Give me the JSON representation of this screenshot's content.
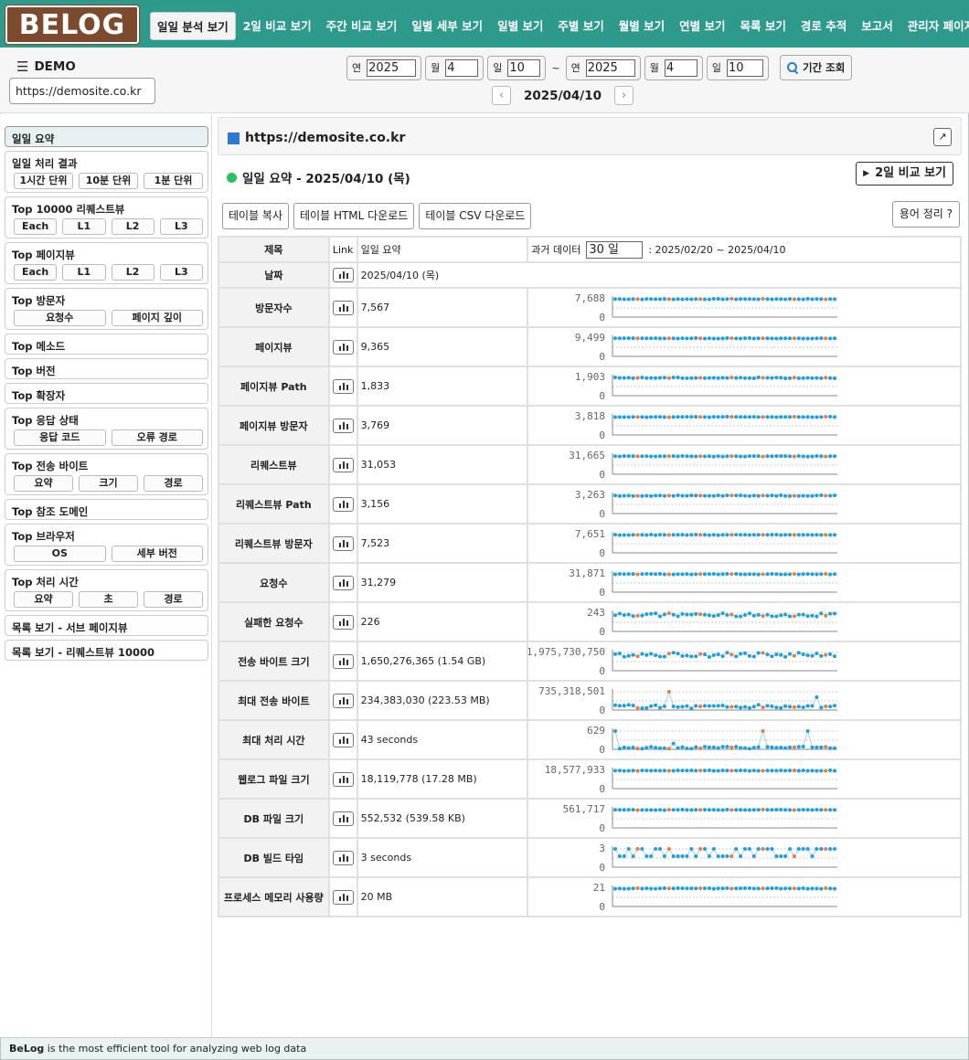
{
  "logo": {
    "text": "BELOG"
  },
  "nav": [
    {
      "label": "일일 분석 보기",
      "active": true
    },
    {
      "label": "2일 비교 보기"
    },
    {
      "label": "주간 비교 보기"
    },
    {
      "label": "일별 세부 보기"
    },
    {
      "label": "일별 보기"
    },
    {
      "label": "주별 보기"
    },
    {
      "label": "월별 보기"
    },
    {
      "label": "연별 보기"
    },
    {
      "label": "목록 보기"
    },
    {
      "label": "경로 추적"
    },
    {
      "label": "보고서"
    },
    {
      "label": "관리자 페이지"
    }
  ],
  "header": {
    "site_name": "DEMO",
    "site_url": "https://demosite.co.kr",
    "from": {
      "year_label": "연",
      "year": "2025",
      "month_label": "월",
      "month": "4",
      "day_label": "일",
      "day": "10"
    },
    "tilde": "~",
    "to": {
      "year_label": "연",
      "year": "2025",
      "month_label": "월",
      "month": "4",
      "day_label": "일",
      "day": "10"
    },
    "search_label": "기간 조회",
    "current_date": "2025/04/10",
    "prev_arrow": "‹",
    "next_arrow": "›"
  },
  "sidebar": [
    {
      "title": "일일 요약",
      "active": true,
      "buttons": []
    },
    {
      "title": "일일 처리 결과",
      "buttons": [
        "1시간 단위",
        "10분 단위",
        "1분 단위"
      ]
    },
    {
      "title": "Top 10000 리퀘스트뷰",
      "buttons": [
        "Each",
        "L1",
        "L2",
        "L3"
      ]
    },
    {
      "title": "Top 페이지뷰",
      "buttons": [
        "Each",
        "L1",
        "L2",
        "L3"
      ]
    },
    {
      "title": "Top 방문자",
      "buttons": [
        "요청수",
        "페이지 깊이"
      ]
    },
    {
      "title": "Top 메소드",
      "buttons": []
    },
    {
      "title": "Top 버전",
      "buttons": []
    },
    {
      "title": "Top 확장자",
      "buttons": []
    },
    {
      "title": "Top 응답 상태",
      "buttons": [
        "응답 코드",
        "오류 경로"
      ]
    },
    {
      "title": "Top 전송 바이트",
      "buttons": [
        "요약",
        "크기",
        "경로"
      ]
    },
    {
      "title": "Top 참조 도메인",
      "buttons": []
    },
    {
      "title": "Top 브라우저",
      "buttons": [
        "OS",
        "세부 버전"
      ]
    },
    {
      "title": "Top 처리 시간",
      "buttons": [
        "요약",
        "초",
        "경로"
      ]
    },
    {
      "title": "목록 보기 - 서브 페이지뷰",
      "buttons": []
    },
    {
      "title": "목록 보기 - 리퀘스트뷰 10000",
      "buttons": []
    }
  ],
  "main": {
    "site_title": "https://demosite.co.kr",
    "ext_icon": "↗",
    "summary_title": "일일 요약 - 2025/04/10 (목)",
    "compare_btn": "2일 비교 보기",
    "compare_icon": "▶",
    "tools": [
      "테이블 복사",
      "테이블 HTML 다운로드",
      "테이블 CSV 다운로드"
    ],
    "glossary": "용어 정리 ?",
    "table": {
      "h_name": "제목",
      "h_link": "Link",
      "h_value": "일일 요약",
      "h_past_label": "과거 데이터",
      "h_days": "30 일",
      "h_range": ": 2025/02/20 ~ 2025/04/10",
      "date_label": "날짜",
      "date_value": "2025/04/10 (목)"
    },
    "rows": [
      {
        "name": "방문자수",
        "value": "7,567",
        "max": "7,688",
        "min": "0",
        "pattern": "flat"
      },
      {
        "name": "페이지뷰",
        "value": "9,365",
        "max": "9,499",
        "min": "0",
        "pattern": "flat"
      },
      {
        "name": "페이지뷰 Path",
        "value": "1,833",
        "max": "1,903",
        "min": "0",
        "pattern": "flat2"
      },
      {
        "name": "페이지뷰 방문자",
        "value": "3,769",
        "max": "3,818",
        "min": "0",
        "pattern": "flat"
      },
      {
        "name": "리퀘스트뷰",
        "value": "31,053",
        "max": "31,665",
        "min": "0",
        "pattern": "flat"
      },
      {
        "name": "리퀘스트뷰 Path",
        "value": "3,156",
        "max": "3,263",
        "min": "0",
        "pattern": "flat2"
      },
      {
        "name": "리퀘스트뷰 방문자",
        "value": "7,523",
        "max": "7,651",
        "min": "0",
        "pattern": "flat"
      },
      {
        "name": "요청수",
        "value": "31,279",
        "max": "31,871",
        "min": "0",
        "pattern": "flat"
      },
      {
        "name": "실패한 요청수",
        "value": "226",
        "max": "243",
        "min": "0",
        "pattern": "wavy"
      },
      {
        "name": "전송 바이트 크기",
        "value": "1,650,276,365 (1.54 GB)",
        "max": "1,975,730,750",
        "min": "0",
        "pattern": "wavy2"
      },
      {
        "name": "최대 전송 바이트",
        "value": "234,383,030 (223.53 MB)",
        "max": "735,318,501",
        "min": "0",
        "pattern": "spiky"
      },
      {
        "name": "최대 처리 시간",
        "value": "43 seconds",
        "max": "629",
        "min": "0",
        "pattern": "spiky2"
      },
      {
        "name": "웹로그 파일 크기",
        "value": "18,119,778 (17.28 MB)",
        "max": "18,577,933",
        "min": "0",
        "pattern": "flat"
      },
      {
        "name": "DB 파일 크기",
        "value": "552,532 (539.58 KB)",
        "max": "561,717",
        "min": "0",
        "pattern": "flat"
      },
      {
        "name": "DB 빌드 타임",
        "value": "3 seconds",
        "max": "3",
        "min": "0",
        "pattern": "steps"
      },
      {
        "name": "프로세스 메모리 사용량",
        "value": "20 MB",
        "max": "21",
        "min": "0",
        "pattern": "flat"
      }
    ]
  },
  "footer": {
    "brand": "BeLog",
    "text": " is the most efficient tool for analyzing web log data"
  },
  "colors": {
    "topbar": "#2e9a8b",
    "logo_bg": "#7c4b2e",
    "point_blue": "#1ea0e0",
    "point_orange": "#f07a3c"
  }
}
